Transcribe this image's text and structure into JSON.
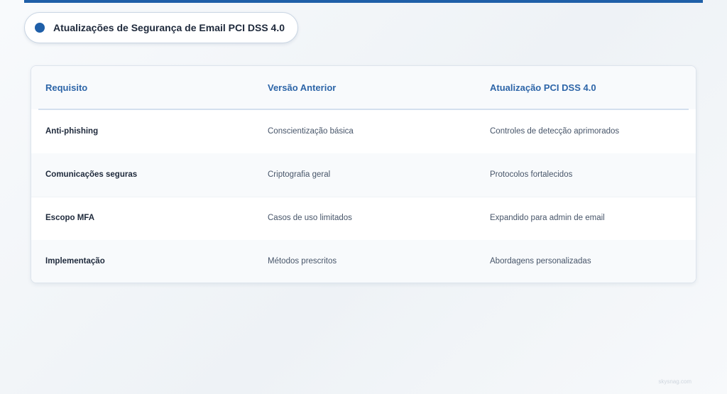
{
  "title": "Atualizações de Segurança de Email PCI DSS 4.0",
  "table": {
    "headers": [
      "Requisito",
      "Versão Anterior",
      "Atualização PCI DSS 4.0"
    ],
    "rows": [
      [
        "Anti-phishing",
        "Conscientização básica",
        "Controles de detecção aprimorados"
      ],
      [
        "Comunicações seguras",
        "Criptografia geral",
        "Protocolos fortalecidos"
      ],
      [
        "Escopo MFA",
        "Casos de uso limitados",
        "Expandido para admin de email"
      ],
      [
        "Implementação",
        "Métodos prescritos",
        "Abordagens personalizadas"
      ]
    ]
  },
  "watermark": "skysnag.com",
  "colors": {
    "accent": "#1f5fa8",
    "header_text": "#2d65a8"
  }
}
